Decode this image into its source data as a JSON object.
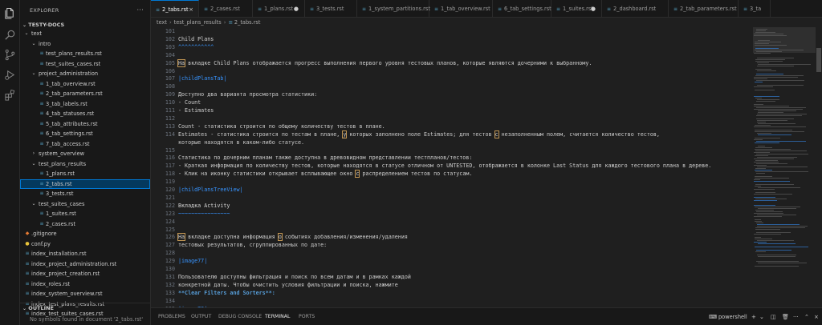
{
  "activity_bar": [
    "files-icon",
    "search-icon",
    "source-control-icon",
    "run-debug-icon",
    "extensions-icon"
  ],
  "sidebar": {
    "title": "EXPLORER",
    "more": "···",
    "workspace": "TESTY-DOCS",
    "tree": [
      {
        "label": "text",
        "type": "folder",
        "open": true
      },
      {
        "label": "intro",
        "type": "folder",
        "open": true
      },
      {
        "label": "test_plans_results.rst",
        "type": "file"
      },
      {
        "label": "test_suites_cases.rst",
        "type": "file"
      },
      {
        "label": "project_administration",
        "type": "folder",
        "open": true
      },
      {
        "label": "1_tab_overview.rst",
        "type": "file"
      },
      {
        "label": "2_tab_parameters.rst",
        "type": "file"
      },
      {
        "label": "3_tab_labels.rst",
        "type": "file"
      },
      {
        "label": "4_tab_statuses.rst",
        "type": "file"
      },
      {
        "label": "5_tab_attributes.rst",
        "type": "file"
      },
      {
        "label": "6_tab_settings.rst",
        "type": "file"
      },
      {
        "label": "7_tab_access.rst",
        "type": "file"
      },
      {
        "label": "system_overview",
        "type": "folder",
        "open": false
      },
      {
        "label": "test_plans_results",
        "type": "folder",
        "open": true
      },
      {
        "label": "1_plans.rst",
        "type": "file"
      },
      {
        "label": "2_tabs.rst",
        "type": "file",
        "selected": true
      },
      {
        "label": "3_tests.rst",
        "type": "file"
      },
      {
        "label": "test_suites_cases",
        "type": "folder",
        "open": true
      },
      {
        "label": "1_suites.rst",
        "type": "file"
      },
      {
        "label": "2_cases.rst",
        "type": "file"
      },
      {
        "label": ".gitignore",
        "type": "git"
      },
      {
        "label": "conf.py",
        "type": "py"
      },
      {
        "label": "index_installation.rst",
        "type": "file"
      },
      {
        "label": "index_project_administration.rst",
        "type": "file"
      },
      {
        "label": "index_project_creation.rst",
        "type": "file"
      },
      {
        "label": "index_roles.rst",
        "type": "file"
      },
      {
        "label": "index_system_overview.rst",
        "type": "file"
      },
      {
        "label": "index_test_plans_results.rst",
        "type": "file"
      },
      {
        "label": "index_test_suites_cases.rst",
        "type": "file"
      }
    ],
    "outline_title": "OUTLINE",
    "outline_msg": "No symbols found in document '2_tabs.rst'"
  },
  "tabs": [
    {
      "label": "2_tabs.rst",
      "active": true,
      "modified": false
    },
    {
      "label": "2_cases.rst",
      "active": false,
      "modified": false
    },
    {
      "label": "1_plans.rst",
      "active": false,
      "modified": true
    },
    {
      "label": "3_tests.rst",
      "active": false,
      "modified": false
    },
    {
      "label": "1_system_partitions.rst",
      "active": false,
      "modified": false
    },
    {
      "label": "1_tab_overview.rst",
      "active": false,
      "modified": false
    },
    {
      "label": "6_tab_settings.rst",
      "active": false,
      "modified": false
    },
    {
      "label": "1_suites.rst",
      "active": false,
      "modified": true
    },
    {
      "label": "2_dashboard.rst",
      "active": false,
      "modified": false
    },
    {
      "label": "2_tab_parameters.rst",
      "active": false,
      "modified": false
    },
    {
      "label": "3_ta",
      "active": false,
      "modified": false
    }
  ],
  "breadcrumbs": [
    "text",
    "test_plans_results",
    "2_tabs.rst"
  ],
  "editor": {
    "lines": [
      {
        "n": "101",
        "parts": [
          {
            "t": ""
          }
        ]
      },
      {
        "n": "102",
        "parts": [
          {
            "t": "Child Plans",
            "c": "c-head"
          }
        ]
      },
      {
        "n": "103",
        "parts": [
          {
            "t": "^^^^^^^^^^^",
            "c": "c-under"
          }
        ]
      },
      {
        "n": "104",
        "parts": [
          {
            "t": ""
          }
        ]
      },
      {
        "n": "105",
        "parts": [
          {
            "t": "На",
            "c": "hl"
          },
          {
            "t": " вкладке Child Plans отображается прогресс выполнения первого уровня тестовых планов, которые являются дочерними к выбранному."
          }
        ]
      },
      {
        "n": "106",
        "parts": [
          {
            "t": ""
          }
        ]
      },
      {
        "n": "107",
        "parts": [
          {
            "t": "|childPlansTab|",
            "c": "c-sub"
          }
        ]
      },
      {
        "n": "108",
        "parts": [
          {
            "t": ""
          }
        ]
      },
      {
        "n": "109",
        "parts": [
          {
            "t": "Доступно два варианта просмотра статистики:"
          }
        ]
      },
      {
        "n": "110",
        "parts": [
          {
            "t": "- Count"
          }
        ]
      },
      {
        "n": "111",
        "parts": [
          {
            "t": "- Estimates"
          }
        ]
      },
      {
        "n": "112",
        "parts": [
          {
            "t": ""
          }
        ]
      },
      {
        "n": "113",
        "parts": [
          {
            "t": "Count - статистика строится по общему количеству тестов в плане."
          }
        ]
      },
      {
        "n": "114",
        "parts": [
          {
            "t": "Estimates - статистика строится по тестам в плане, "
          },
          {
            "t": "у",
            "c": "hl"
          },
          {
            "t": " которых заполнено поле Estimates; для тестов "
          },
          {
            "t": "с",
            "c": "hl"
          },
          {
            "t": " незаполненным полем, считается количество тестов,"
          }
        ]
      },
      {
        "n": "",
        "parts": [
          {
            "t": "которые находятся в каком-либо статусе."
          }
        ]
      },
      {
        "n": "115",
        "parts": [
          {
            "t": ""
          }
        ]
      },
      {
        "n": "116",
        "parts": [
          {
            "t": "Статистика по дочерним планам также доступна в древовидном представлении тестпланов/тестов:"
          }
        ]
      },
      {
        "n": "117",
        "parts": [
          {
            "t": "- Краткая информация по количеству тестов, которые находятся в статусе отличном от UNTESTED, отображается в колонке Last Status для каждого тестового плана в дереве."
          }
        ]
      },
      {
        "n": "118",
        "parts": [
          {
            "t": "- Клик на иконку статистики открывает всплывающее окно "
          },
          {
            "t": "с",
            "c": "hl"
          },
          {
            "t": " распределением тестов по статусам."
          }
        ]
      },
      {
        "n": "119",
        "parts": [
          {
            "t": ""
          }
        ]
      },
      {
        "n": "120",
        "parts": [
          {
            "t": "|childPlansTreeView|",
            "c": "c-sub"
          }
        ]
      },
      {
        "n": "121",
        "parts": [
          {
            "t": ""
          }
        ]
      },
      {
        "n": "122",
        "parts": [
          {
            "t": "Вкладка Activity",
            "c": "c-head"
          }
        ]
      },
      {
        "n": "123",
        "parts": [
          {
            "t": "~~~~~~~~~~~~~~~~",
            "c": "c-under"
          }
        ]
      },
      {
        "n": "124",
        "parts": [
          {
            "t": ""
          }
        ]
      },
      {
        "n": "125",
        "parts": [
          {
            "t": ""
          }
        ]
      },
      {
        "n": "126",
        "parts": [
          {
            "t": "На",
            "c": "hl"
          },
          {
            "t": " вкладке доступна информация "
          },
          {
            "t": "о",
            "c": "hl"
          },
          {
            "t": " событиях добавления/изменения/удаления"
          }
        ]
      },
      {
        "n": "127",
        "parts": [
          {
            "t": "тестовых результатов, сгруппированных по дате:"
          }
        ]
      },
      {
        "n": "128",
        "parts": [
          {
            "t": ""
          }
        ]
      },
      {
        "n": "129",
        "parts": [
          {
            "t": "|image77|",
            "c": "c-sub"
          }
        ]
      },
      {
        "n": "130",
        "parts": [
          {
            "t": ""
          }
        ]
      },
      {
        "n": "131",
        "parts": [
          {
            "t": "Пользователю доступны фильтрация и поиск по всем датам и в рамках каждой"
          }
        ]
      },
      {
        "n": "132",
        "parts": [
          {
            "t": "конкретной даты. Чтобы очистить условия фильтрации и поиска, нажмите"
          }
        ]
      },
      {
        "n": "133",
        "parts": [
          {
            "t": "**Clear Filters and Sorters**:",
            "c": "c-bold"
          }
        ]
      },
      {
        "n": "134",
        "parts": [
          {
            "t": ""
          }
        ]
      },
      {
        "n": "135",
        "parts": [
          {
            "t": "|image78|",
            "c": "c-sub"
          }
        ]
      }
    ]
  },
  "panel": {
    "tabs": [
      "PROBLEMS",
      "OUTPUT",
      "DEBUG CONSOLE",
      "TERMINAL",
      "PORTS"
    ],
    "active": "TERMINAL",
    "shell": "powershell",
    "icons": [
      "plus-icon",
      "chevron-down-icon",
      "split-icon",
      "trash-icon",
      "more-icon",
      "chevron-up-icon",
      "close-icon"
    ]
  }
}
